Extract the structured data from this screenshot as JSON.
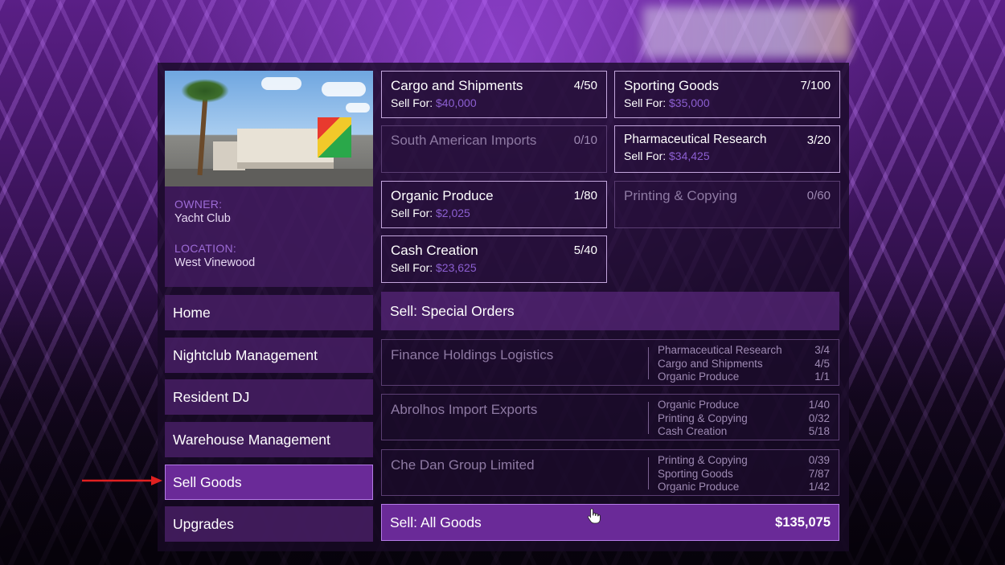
{
  "property": {
    "owner_label": "OWNER:",
    "owner_value": "Yacht Club",
    "location_label": "LOCATION:",
    "location_value": "West Vinewood"
  },
  "menu": {
    "items": [
      {
        "label": "Home"
      },
      {
        "label": "Nightclub Management"
      },
      {
        "label": "Resident DJ"
      },
      {
        "label": "Warehouse Management"
      },
      {
        "label": "Sell Goods",
        "selected": true
      },
      {
        "label": "Upgrades"
      }
    ]
  },
  "goods": [
    {
      "name": "Cargo and Shipments",
      "count": "4/50",
      "sell_label": "Sell For:",
      "price": "$40,000"
    },
    {
      "name": "Sporting Goods",
      "count": "7/100",
      "sell_label": "Sell For:",
      "price": "$35,000"
    },
    {
      "name": "South American Imports",
      "count": "0/10"
    },
    {
      "name": "Pharmaceutical Research",
      "count": "3/20",
      "sell_label": "Sell For:",
      "price": "$34,425"
    },
    {
      "name": "Organic Produce",
      "count": "1/80",
      "sell_label": "Sell For:",
      "price": "$2,025"
    },
    {
      "name": "Printing & Copying",
      "count": "0/60"
    },
    {
      "name": "Cash Creation",
      "count": "5/40",
      "sell_label": "Sell For:",
      "price": "$23,625"
    }
  ],
  "special_orders": {
    "header": "Sell: Special Orders",
    "orders": [
      {
        "name": "Finance Holdings Logistics",
        "items": [
          {
            "good": "Pharmaceutical Research",
            "qty": "3/4"
          },
          {
            "good": "Cargo and Shipments",
            "qty": "4/5"
          },
          {
            "good": "Organic Produce",
            "qty": "1/1"
          }
        ]
      },
      {
        "name": "Abrolhos Import Exports",
        "items": [
          {
            "good": "Organic Produce",
            "qty": "1/40"
          },
          {
            "good": "Printing & Copying",
            "qty": "0/32"
          },
          {
            "good": "Cash Creation",
            "qty": "5/18"
          }
        ]
      },
      {
        "name": "Che Dan Group Limited",
        "items": [
          {
            "good": "Printing & Copying",
            "qty": "0/39"
          },
          {
            "good": "Sporting Goods",
            "qty": "7/87"
          },
          {
            "good": "Organic Produce",
            "qty": "1/42"
          }
        ]
      }
    ]
  },
  "sell_all": {
    "label": "Sell: All Goods",
    "total": "$135,075"
  },
  "colors": {
    "accent": "#6a2a98",
    "price": "#8c5fd1",
    "arrow": "#e02020"
  }
}
